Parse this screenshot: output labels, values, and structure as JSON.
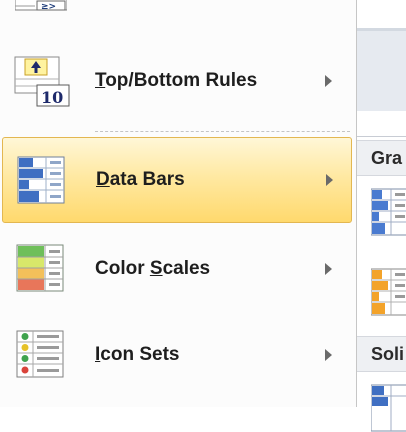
{
  "menu": {
    "items": [
      {
        "label_pre": "",
        "label_key": "T",
        "label_post": "op/Bottom Rules",
        "icon": "top-bottom-rules-icon",
        "icon_text": "10"
      },
      {
        "label_pre": "",
        "label_key": "D",
        "label_post": "ata Bars",
        "icon": "data-bars-icon"
      },
      {
        "label_pre": "Color ",
        "label_key": "S",
        "label_post": "cales",
        "icon": "color-scales-icon"
      },
      {
        "label_pre": "",
        "label_key": "I",
        "label_post": "con Sets",
        "icon": "icon-sets-icon"
      }
    ],
    "highlighted_index": 1
  },
  "gallery": {
    "headers": [
      "Gra",
      "Soli"
    ]
  },
  "colors": {
    "highlight_border": "#e3b751",
    "data_bar_blue": "#4472c4",
    "data_bar_orange": "#f39c12"
  }
}
